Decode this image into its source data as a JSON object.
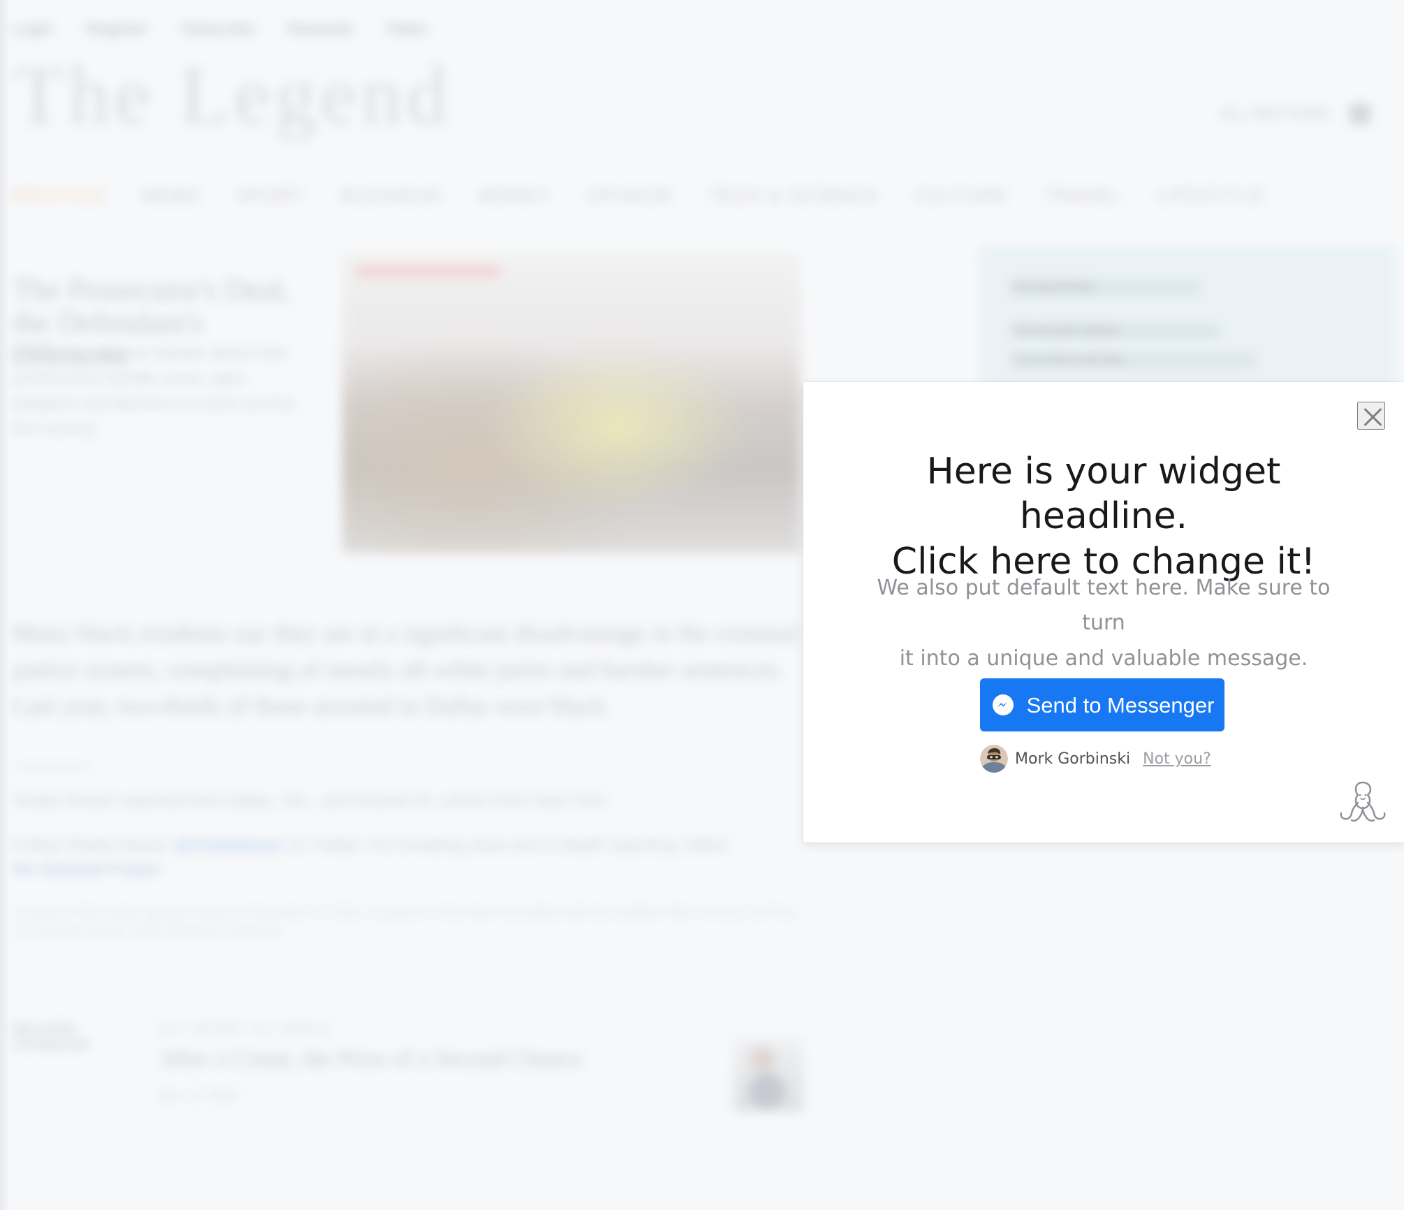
{
  "background": {
    "top_links": [
      "Login",
      "Register",
      "Subscribe",
      "Rewards",
      "Video"
    ],
    "masthead": "The Legend",
    "masthead_right": "ALL SECTIONS",
    "nav": [
      "POLITICS",
      "NEWS",
      "SPORT",
      "BUSINESS",
      "MONEY",
      "OPINION",
      "TECH & SCIENCE",
      "CULTURE",
      "TRAVEL",
      "LIFESTYLE"
    ],
    "hero_title": "The Prosecutor's Deal, the Defendant's Dilemma",
    "hero_dek": "A growing national debate about how prosecutors handle cases, plea bargains and fairness in courts across the country.",
    "promo_lines": [
      "Morning Briefing",
      "Get essential updates",
      "in your inbox each day"
    ],
    "article_paragraph": "Many black residents say they are at a significant disadvantage in the criminal justice system, complaining of mostly all-white juries and harsher sentences. Last year, two-thirds of those arrested in Dallas were black.",
    "byline": "Shaila Dewan reported from Dallas, Tex., and Andrew W. Lehren from New York.",
    "follow_prefix": "Follow Shaila Dewan ",
    "follow_handle": "@shailadewan",
    "follow_suffix": " on Twitter. For breaking news and in-depth reporting, follow",
    "follow_link": "the Marshall Project",
    "print_note": "A version of this article appears in print on December 13, 2016, on page A1 of the New York edition with the headline: After a Crime, the Price of a Second Chance.  Order Reprints | Subscribe",
    "related_label": "RELATED COVERAGE",
    "related_kicker": "ALL SOUND, ALL ANGLE",
    "related_title": "After a Crime, the Price of a Second Chance",
    "related_date": "Dec. 12, 2016"
  },
  "widget": {
    "headline_line1": "Here is your widget headline.",
    "headline_line2": "Click here to change it!",
    "body_line1": "We also put default text here. Make sure to turn",
    "body_line2": "it into a unique and valuable message.",
    "button_label": "Send to Messenger",
    "user_name": "Mork Gorbinski",
    "not_you": "Not you?",
    "icons": {
      "close": "close-icon",
      "messenger": "messenger-icon",
      "avatar": "avatar",
      "brand": "octopus-icon"
    },
    "colors": {
      "button": "#1877f2",
      "headline": "#18191b",
      "body": "#8f9297"
    }
  }
}
